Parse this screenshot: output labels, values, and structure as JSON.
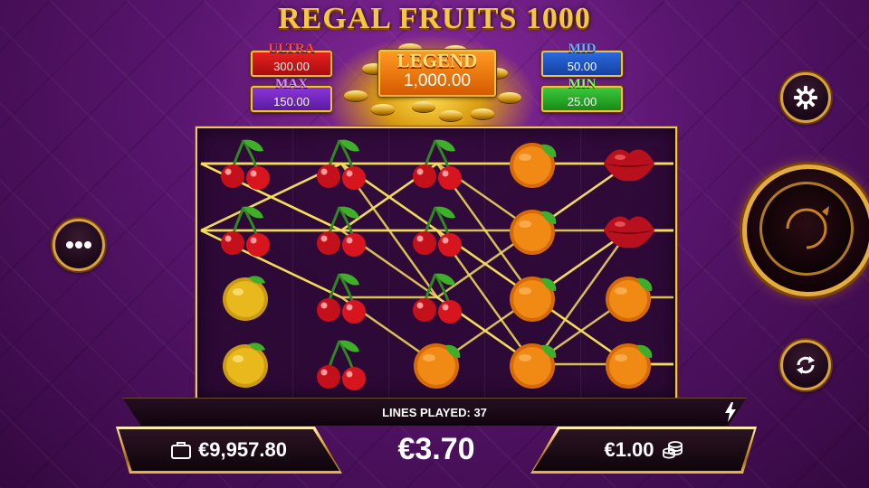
{
  "game": {
    "title": "REGAL FRUITS 1000"
  },
  "jackpots": {
    "ultra": {
      "name": "ULTRA",
      "value": "300.00"
    },
    "max": {
      "name": "MAX",
      "value": "150.00"
    },
    "legend": {
      "name": "LEGEND",
      "value": "1,000.00"
    },
    "mid": {
      "name": "MID",
      "value": "50.00"
    },
    "min": {
      "name": "MIN",
      "value": "25.00"
    }
  },
  "reels": {
    "columns": [
      [
        "cherry",
        "cherry",
        "lemon",
        "lemon"
      ],
      [
        "cherry",
        "cherry",
        "cherry",
        "cherry"
      ],
      [
        "cherry",
        "cherry",
        "cherry",
        "orange"
      ],
      [
        "orange",
        "orange",
        "orange",
        "orange"
      ],
      [
        "lips",
        "lips",
        "orange",
        "orange"
      ]
    ]
  },
  "controls": {
    "settings_icon": "gear-icon",
    "menu_icon": "more-dots-icon",
    "spin_icon": "spin-arrow-icon",
    "autoplay_icon": "autoplay-icon"
  },
  "info": {
    "lines_played": "LINES PLAYED: 37",
    "quick_spin_icon": "lightning-icon"
  },
  "wallet": {
    "balance": "€9,957.80",
    "balance_icon": "wallet-icon",
    "total_bet": "€3.70",
    "stake": "€1.00",
    "stake_icon": "coins-icon"
  },
  "colors": {
    "gold": "#f1c458",
    "ultra": "#d81818",
    "max": "#7a2ac8",
    "legend": "#f07a10",
    "mid": "#2258c8",
    "min": "#2aa62a"
  }
}
